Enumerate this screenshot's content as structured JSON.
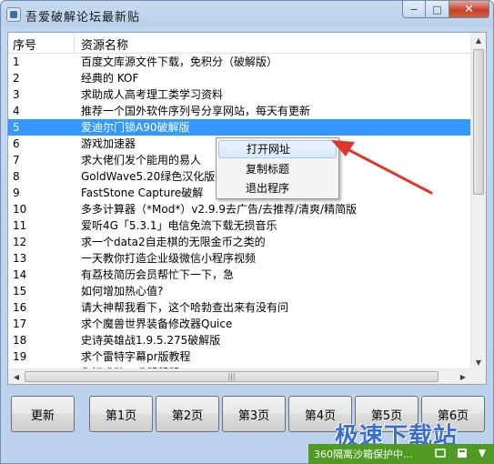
{
  "window": {
    "title": "吾爱破解论坛最新贴",
    "close_label": "✕",
    "max_label": "□",
    "min_label": "−"
  },
  "list": {
    "columns": [
      "序号",
      "资源名称"
    ],
    "selected_index": 5,
    "rows": [
      {
        "num": "1",
        "name": "百度文库源文件下载，免积分（破解版）"
      },
      {
        "num": "2",
        "name": "经典的 KOF"
      },
      {
        "num": "3",
        "name": "求助成人高考理工类学习资料"
      },
      {
        "num": "4",
        "name": "推荐一个国外软件序列号分享网站，每天有更新"
      },
      {
        "num": "5",
        "name": "爱迪尔门锁A90破解版"
      },
      {
        "num": "6",
        "name": "游戏加速器"
      },
      {
        "num": "7",
        "name": "求大佬们发个能用的易人"
      },
      {
        "num": "8",
        "name": "GoldWave5.20绿色汉化版                              换软件）"
      },
      {
        "num": "9",
        "name": "FastStone Capture破解"
      },
      {
        "num": "10",
        "name": "多多计算器（*Mod*）v2.9.9去广告/去推荐/清爽/精简版"
      },
      {
        "num": "11",
        "name": "爱听4G「5.3.1」电信免流下载无损音乐"
      },
      {
        "num": "12",
        "name": "求一个data2自走棋的无限金币之类的"
      },
      {
        "num": "13",
        "name": "一天教你打造企业级微信小程序视频"
      },
      {
        "num": "14",
        "name": "有荔枝简历会员帮忙下一下，急"
      },
      {
        "num": "15",
        "name": "如何增加热心值?"
      },
      {
        "num": "16",
        "name": "请大神帮我看下，这个哈勃查出来有没有问"
      },
      {
        "num": "17",
        "name": "求个魔兽世界装备修改器Quice"
      },
      {
        "num": "18",
        "name": "史诗英雄战1.9.5.275破解版"
      },
      {
        "num": "19",
        "name": "求个雷特字幕pr版教程"
      },
      {
        "num": "20",
        "name": "你好求助，求帮帮帮"
      }
    ]
  },
  "context_menu": {
    "items": [
      "打开网址",
      "复制标题",
      "退出程序"
    ]
  },
  "buttons": {
    "refresh": "更新",
    "pages": [
      "第1页",
      "第2页",
      "第3页",
      "第4页",
      "第5页",
      "第6页"
    ]
  },
  "status": {
    "text": "360隔离沙箱保护中..."
  },
  "watermark": "极速下载站",
  "colors": {
    "selection": "#3399ff",
    "status_green": "#4f9a22",
    "close_red": "#c8432b",
    "arrow_red": "#e0352b"
  }
}
